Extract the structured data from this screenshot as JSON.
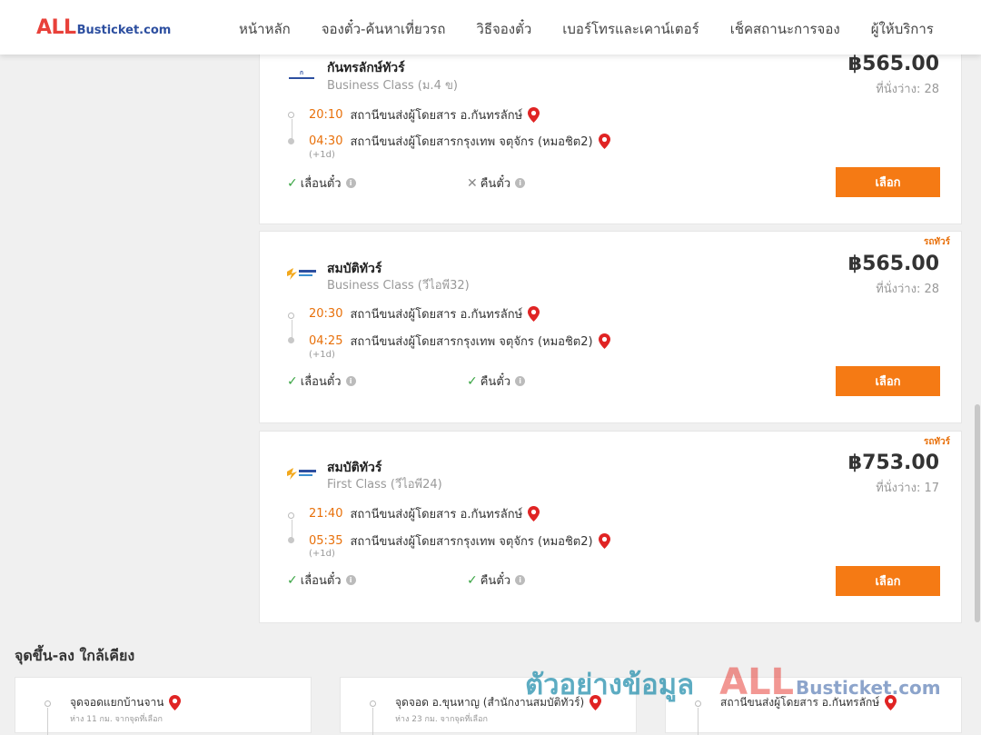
{
  "header": {
    "logo_all": "ALL",
    "logo_rest": "Busticket.com",
    "nav": [
      "หน้าหลัก",
      "จองตั๋ว-ค้นหาเที่ยวรถ",
      "วิธีจองตั๋ว",
      "เบอร์โทรและเคาน์เตอร์",
      "เช็คสถานะการจอง",
      "ผู้ให้บริการ"
    ]
  },
  "trips": [
    {
      "tag": "",
      "operator": "กันทรลักษ์ทัวร์",
      "class": "Business Class (ม.4 ข)",
      "price": "฿565.00",
      "seats": "ที่นั่งว่าง: 28",
      "depart_time": "20:10",
      "depart_station": "สถานีขนส่งผู้โดยสาร อ.กันทรลักษ์",
      "arrive_time": "04:30",
      "arrive_station": "สถานีขนส่งผู้โดยสารกรุงเทพ จตุจักร (หมอชิต2)",
      "plus_day": "(+1d)",
      "reschedule": "เลื่อนตั๋ว",
      "refund": "คืนตั๋ว",
      "select": "เลือก"
    },
    {
      "tag": "รถทัวร์",
      "operator": "สมบัติทัวร์",
      "class": "Business Class (วีไอพี32)",
      "price": "฿565.00",
      "seats": "ที่นั่งว่าง: 28",
      "depart_time": "20:30",
      "depart_station": "สถานีขนส่งผู้โดยสาร อ.กันทรลักษ์",
      "arrive_time": "04:25",
      "arrive_station": "สถานีขนส่งผู้โดยสารกรุงเทพ จตุจักร (หมอชิต2)",
      "plus_day": "(+1d)",
      "reschedule": "เลื่อนตั๋ว",
      "refund": "คืนตั๋ว",
      "select": "เลือก"
    },
    {
      "tag": "รถทัวร์",
      "operator": "สมบัติทัวร์",
      "class": "First Class (วีไอพี24)",
      "price": "฿753.00",
      "seats": "ที่นั่งว่าง: 17",
      "depart_time": "21:40",
      "depart_station": "สถานีขนส่งผู้โดยสาร อ.กันทรลักษ์",
      "arrive_time": "05:35",
      "arrive_station": "สถานีขนส่งผู้โดยสารกรุงเทพ จตุจักร (หมอชิต2)",
      "plus_day": "(+1d)",
      "reschedule": "เลื่อนตั๋ว",
      "refund": "คืนตั๋ว",
      "select": "เลือก"
    }
  ],
  "nearby": {
    "title": "จุดขึ้น-ลง ใกล้เคียง",
    "items": [
      {
        "name": "จุดจอดแยกบ้านจาน",
        "distance": "ห่าง 11 กม. จากจุดที่เลือก"
      },
      {
        "name": "จุดจอด อ.ขุนหาญ (สำนักงานสมบัติทัวร์)",
        "distance": "ห่าง 23 กม. จากจุดที่เลือก"
      },
      {
        "name": "สถานีขนส่งผู้โดยสาร อ.กันทรลักษ์",
        "distance": ""
      }
    ]
  },
  "watermark": {
    "thai": "ตัวอย่างข้อมูล",
    "all": "ALL",
    "rest": "Busticket.com"
  },
  "colors": {
    "accent": "#f57a14",
    "time": "#e8700a",
    "brand_red": "#e8413a",
    "brand_blue": "#2d4fa0",
    "check": "#3aa544"
  },
  "icons": {
    "pin": "map-pin-icon",
    "check": "check-icon",
    "cross": "cross-icon",
    "info": "info-icon"
  }
}
